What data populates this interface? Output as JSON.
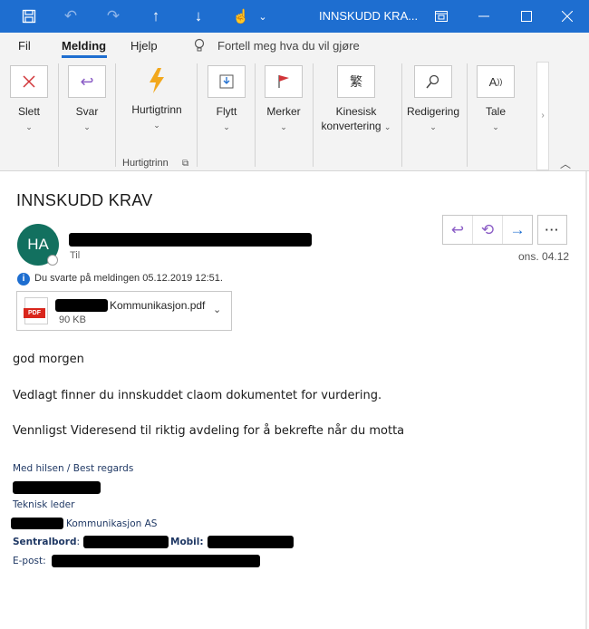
{
  "titlebar": {
    "title": "INNSKUDD KRA...",
    "icons": [
      "save-icon",
      "undo-icon",
      "redo-icon",
      "arrow-up-icon",
      "arrow-down-icon",
      "touch-mode-icon",
      "customize-chevron-icon",
      "restore-window-icon",
      "minimize-icon",
      "close-icon"
    ]
  },
  "menubar": {
    "items": [
      {
        "label": "Fil"
      },
      {
        "label": "Melding"
      },
      {
        "label": "Hjelp"
      }
    ],
    "tell_me": "Fortell meg hva du vil gjøre"
  },
  "ribbon": {
    "buttons": {
      "slett": "Slett",
      "svar": "Svar",
      "hurtigtrinn": "Hurtigtrinn",
      "flytt": "Flytt",
      "merker": "Merker",
      "kinesisk_1": "Kinesisk",
      "kinesisk_2": "konvertering",
      "redigering": "Redigering",
      "tale": "Tale"
    },
    "group_label": "Hurtigtrinn",
    "chevron": "⌄",
    "colors": {
      "delete": "#d13438",
      "reply": "#8b5dc6",
      "lightning": "#f2a81d",
      "flag": "#d13438"
    }
  },
  "message": {
    "subject": "INNSKUDD KRAV",
    "avatar_initials": "HA",
    "to_label": "Til",
    "date": "ons. 04.12",
    "info": "Du svarte på meldingen 05.12.2019 12:51.",
    "attachment": {
      "name": "Kommunikasjon.pdf",
      "size": "90 KB",
      "badge": "PDF"
    },
    "body": [
      "god morgen",
      "Vedlagt finner du innskuddet claom dokumentet for vurdering.",
      "Vennligst Videresend til riktig avdeling for å bekrefte når du motta"
    ],
    "signature": {
      "greeting": "Med hilsen / Best regards",
      "title": "Teknisk leder",
      "company": "Kommunikasjon AS",
      "sentralbord_label": "Sentralbord",
      "mobil_label": "Mobil:",
      "epost_label": "E-post:",
      "colon": ":"
    }
  }
}
